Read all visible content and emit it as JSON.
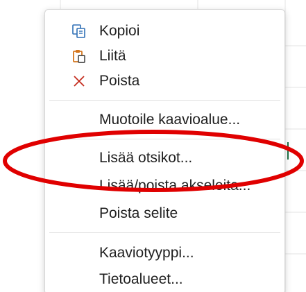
{
  "menu": {
    "items": [
      {
        "label": "Kopioi",
        "icon": "copy-icon"
      },
      {
        "label": "Liitä",
        "icon": "paste-icon"
      },
      {
        "label": "Poista",
        "icon": "delete-x-icon"
      },
      {
        "label": "Muotoile kaavioalue..."
      },
      {
        "label": "Lisää otsikot..."
      },
      {
        "label": "Lisää/poista akseleita..."
      },
      {
        "label": "Poista selite"
      },
      {
        "label": "Kaaviotyyppi..."
      },
      {
        "label": "Tietoalueet..."
      }
    ]
  },
  "highlight": {
    "shape": "ellipse",
    "color": "#e00000",
    "target": "Lisää otsikot..."
  },
  "colors": {
    "icon_blue": "#2f6fb5",
    "icon_orange": "#d4761e",
    "delete_red": "#c42b1c",
    "text": "#1f1f1f"
  }
}
